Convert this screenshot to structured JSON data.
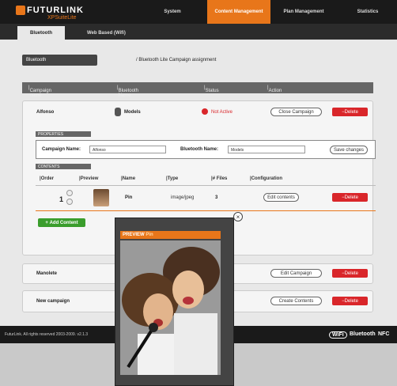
{
  "app": {
    "logo_text": "FUTURLINK",
    "logo_sub": "XPSuiteLite"
  },
  "nav": {
    "items": [
      {
        "label": "System",
        "active": false
      },
      {
        "label": "Content Management",
        "active": true
      },
      {
        "label": "Plan Management",
        "active": false
      },
      {
        "label": "Statistics",
        "active": false
      }
    ]
  },
  "subnav": {
    "bluetooth": "Bluetooth",
    "webbased": "Web Based (Wifi)"
  },
  "page": {
    "label": "Bluetooth",
    "breadcrumb": "/ Bluetooth Lite Campaign assignment"
  },
  "table_headers": [
    "Campaign name",
    "Bluetooth Name",
    "Status",
    "Action"
  ],
  "campaigns": [
    {
      "name": "Alfonso",
      "bt_name": "Models",
      "status": "Not Active",
      "action": "Close Campaign",
      "delete": "Delete"
    },
    {
      "name": "Manolete",
      "action": "Edit Campaign",
      "delete": "Delete"
    },
    {
      "name": "New campaign",
      "action": "Create Contents",
      "delete": "Delete"
    }
  ],
  "properties": {
    "header": "PROPERTIES",
    "campaign_name_label": "Campaign Name:",
    "campaign_name_value": "Alfonso",
    "bt_name_label": "Bluetooth Name:",
    "bt_name_value": "Models",
    "save_label": "Save changes"
  },
  "contents": {
    "header": "CONTENTS",
    "columns": [
      "Order",
      "Preview",
      "Name",
      "Type",
      "# Files",
      "Configuration"
    ],
    "row": {
      "order": "1",
      "name": "Pin",
      "type": "image/jpeg",
      "files": "3",
      "edit": "Edit contents",
      "delete": "Delete"
    },
    "add_label": "Add Content"
  },
  "preview": {
    "label": "PREVIEW",
    "name": "Pin"
  },
  "footer": {
    "copyright": "FuturLink. All rights reserved 2003-2009. v2.1.3",
    "logos": [
      "WiFi",
      "Bluetooth",
      "NFC"
    ]
  },
  "colors": {
    "accent": "#e8761a",
    "danger": "#d9262a",
    "success": "#3a9d2c"
  }
}
